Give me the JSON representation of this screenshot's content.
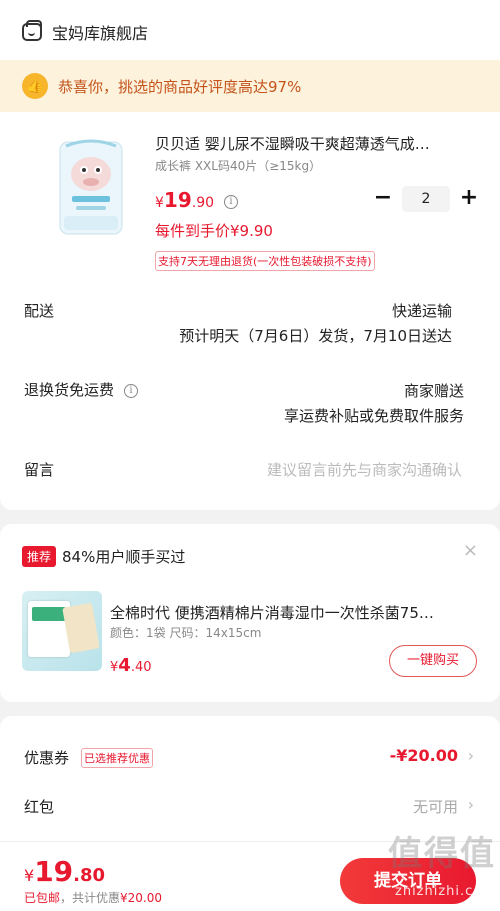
{
  "shop": {
    "name": "宝妈库旗舰店",
    "icon": "shop-icon"
  },
  "congrats": {
    "text": "恭喜你，挑选的商品好评度高达97%",
    "icon": "thumbs-up-icon"
  },
  "product": {
    "title": "贝贝适 婴儿尿不湿瞬吸干爽超薄透气成…",
    "spec": "成长裤 XXL码40片（≥15kg）",
    "price_symbol": "¥",
    "price_int": "19",
    "price_dec": ".90",
    "unit_price": "每件到手价¥9.90",
    "return_badge": "支持7天无理由退货(一次性包装破损不支持)",
    "quantity": "2",
    "minus": "−",
    "plus": "+"
  },
  "delivery": {
    "label": "配送",
    "method": "快递运输",
    "eta": "预计明天（7月6日）发货，7月10日送达"
  },
  "return_fee": {
    "label": "退换货免运费",
    "value1": "商家赠送",
    "value2": "享运费补贴或免费取件服务"
  },
  "message": {
    "label": "留言",
    "placeholder": "建议留言前先与商家沟通确认"
  },
  "recommend": {
    "tag": "推荐",
    "headline": "84%用户顺手买过",
    "close": "×",
    "title": "全棉时代 便携酒精棉片消毒湿巾一次性杀菌75…",
    "spec": "颜色：1袋   尺码：14x15cm",
    "price_symbol": "¥",
    "price_int": "4",
    "price_dec": ".40",
    "buy_label": "一键购买"
  },
  "coupon": {
    "label": "优惠券",
    "tag": "已选推荐优惠",
    "value": "-¥20.00",
    "chevron": "›"
  },
  "red_packet": {
    "label": "红包",
    "value": "无可用",
    "chevron": "›"
  },
  "footer": {
    "price_symbol": "¥",
    "price_int": "19",
    "price_dec": ".80",
    "shipping": "已包邮",
    "savings_prefix": "，共计优惠",
    "savings": "¥20.00",
    "submit": "提交订单",
    "watermark": "值得值",
    "watermark_sub": "zhizhizhi.com"
  },
  "colors": {
    "accent": "#e8192f",
    "banner_bg": "#fdf2dc",
    "banner_text": "#c4541b"
  }
}
